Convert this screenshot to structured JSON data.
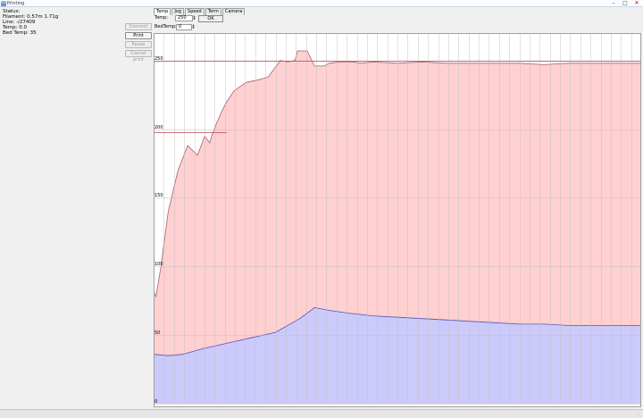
{
  "window": {
    "title": "Printing",
    "minimize": "–",
    "maximize": "□",
    "close": "✕",
    "title_icon": "app-icon"
  },
  "status": {
    "heading": "Status:",
    "filament": "Filament: 0.57m 1.71g",
    "line": "Line: -/27409",
    "temp": "Temp: 0.0",
    "bed_temp": "Bed Temp: 35"
  },
  "buttons": {
    "connect": "Connect",
    "print": "Print",
    "pause": "Pause",
    "cancel": "Cancel print"
  },
  "tabs": [
    {
      "label": "Temp",
      "active": true
    },
    {
      "label": "Jog",
      "active": false
    },
    {
      "label": "Speed",
      "active": false
    },
    {
      "label": "Term",
      "active": false
    },
    {
      "label": "Camera",
      "active": false
    }
  ],
  "temp_controls": {
    "temp_label": "Temp:",
    "temp_value": "250",
    "set_button": "OK",
    "bed_label": "BedTemp:",
    "bed_value": "0"
  },
  "colors": {
    "hotend_fill": "#ffd0d0",
    "hotend_line": "#aa6070",
    "bed_fill": "#cccafa",
    "bed_line": "#5050c0",
    "target_line": "#c04050",
    "grid": "#c0c0c0"
  },
  "chart_data": {
    "type": "area",
    "title": "",
    "xlabel": "",
    "ylabel": "",
    "ylim": [
      0,
      270
    ],
    "yticks": [
      0,
      50,
      100,
      150,
      200,
      250
    ],
    "grid": true,
    "series": [
      {
        "key": "hotend",
        "x": [
          0,
          1,
          3,
          6,
          10,
          14,
          18,
          21,
          23,
          24,
          26,
          28,
          30,
          33,
          38,
          43,
          47,
          52,
          55,
          58,
          59,
          60,
          61,
          63,
          66,
          70,
          72,
          76,
          82,
          85,
          90,
          100,
          110,
          120,
          130,
          140,
          150,
          160,
          170,
          180,
          190,
          200
        ],
        "values": [
          82,
          78,
          100,
          140,
          170,
          188,
          181,
          195,
          190,
          196,
          205,
          213,
          220,
          228,
          234,
          236,
          238,
          250,
          249,
          250,
          257,
          257,
          257,
          257,
          246,
          246,
          248,
          249,
          249,
          248,
          249,
          248,
          249,
          248,
          248,
          248,
          248,
          247,
          248,
          248,
          248,
          248
        ]
      },
      {
        "key": "bed",
        "x": [
          0,
          6,
          12,
          20,
          30,
          40,
          50,
          60,
          66,
          72,
          80,
          90,
          100,
          110,
          120,
          130,
          140,
          150,
          160,
          170,
          180,
          190,
          200
        ],
        "values": [
          36,
          35,
          36,
          40,
          44,
          48,
          52,
          62,
          70,
          68,
          66,
          64,
          63,
          62,
          61,
          60,
          59,
          58,
          58,
          57,
          57,
          57,
          57
        ]
      }
    ],
    "targets": [
      {
        "y": 198,
        "x_from": 0,
        "x_to": 30
      },
      {
        "y": 250,
        "x_from": 0,
        "x_to": 200
      }
    ]
  }
}
